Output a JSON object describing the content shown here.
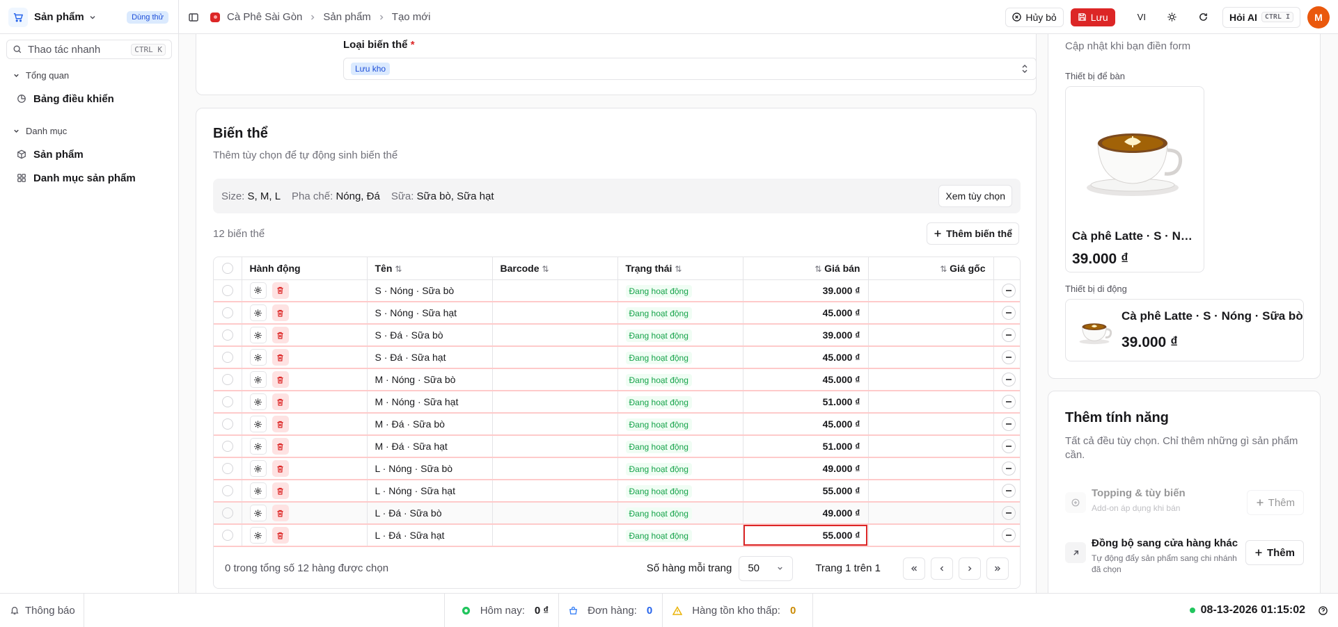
{
  "topbar": {
    "app_name": "Sản phẩm",
    "trial_badge": "Dùng thử",
    "breadcrumb": [
      "Cà Phê Sài Gòn",
      "Sản phẩm",
      "Tạo mới"
    ],
    "cancel_label": "Hủy bỏ",
    "save_label": "Lưu",
    "lang": "VI",
    "ask_ai_label": "Hỏi AI",
    "ask_ai_kbd": "CTRL I",
    "avatar_initial": "M"
  },
  "sidebar": {
    "quick_action_placeholder": "Thao tác nhanh",
    "quick_action_kbd": "CTRL K",
    "groups": [
      {
        "label": "Tổng quan",
        "items": [
          {
            "label": "Bảng điều khiển",
            "icon": "dashboard-icon"
          }
        ]
      },
      {
        "label": "Danh mục",
        "items": [
          {
            "label": "Sản phẩm",
            "icon": "box-icon"
          },
          {
            "label": "Danh mục sản phẩm",
            "icon": "grid-icon"
          }
        ]
      }
    ]
  },
  "variant_type": {
    "label": "Loại biến thể",
    "required_mark": "*",
    "value": "Lưu kho"
  },
  "variants": {
    "title": "Biến thể",
    "subtitle": "Thêm tùy chọn để tự động sinh biến thể",
    "options": [
      {
        "key": "Size:",
        "value": "S, M, L"
      },
      {
        "key": "Pha chế:",
        "value": "Nóng, Đá"
      },
      {
        "key": "Sữa:",
        "value": "Sữa bò, Sữa hạt"
      }
    ],
    "view_options_label": "Xem tùy chọn",
    "count_label": "12 biến thể",
    "add_variant_label": "Thêm biến thể",
    "columns": [
      "Hành động",
      "Tên",
      "Barcode",
      "Trạng thái",
      "Giá bán",
      "Giá gốc"
    ],
    "rows": [
      {
        "name": "S · Nóng · Sữa bò",
        "barcode": "",
        "status": "Đang hoạt động",
        "price": "39.000 ₫",
        "cost": ""
      },
      {
        "name": "S · Nóng · Sữa hạt",
        "barcode": "",
        "status": "Đang hoạt động",
        "price": "45.000 ₫",
        "cost": ""
      },
      {
        "name": "S · Đá · Sữa bò",
        "barcode": "",
        "status": "Đang hoạt động",
        "price": "39.000 ₫",
        "cost": ""
      },
      {
        "name": "S · Đá · Sữa hạt",
        "barcode": "",
        "status": "Đang hoạt động",
        "price": "45.000 ₫",
        "cost": ""
      },
      {
        "name": "M · Nóng · Sữa bò",
        "barcode": "",
        "status": "Đang hoạt động",
        "price": "45.000 ₫",
        "cost": ""
      },
      {
        "name": "M · Nóng · Sữa hạt",
        "barcode": "",
        "status": "Đang hoạt động",
        "price": "51.000 ₫",
        "cost": ""
      },
      {
        "name": "M · Đá · Sữa bò",
        "barcode": "",
        "status": "Đang hoạt động",
        "price": "45.000 ₫",
        "cost": ""
      },
      {
        "name": "M · Đá · Sữa hạt",
        "barcode": "",
        "status": "Đang hoạt động",
        "price": "51.000 ₫",
        "cost": ""
      },
      {
        "name": "L · Nóng · Sữa bò",
        "barcode": "",
        "status": "Đang hoạt động",
        "price": "49.000 ₫",
        "cost": ""
      },
      {
        "name": "L · Nóng · Sữa hạt",
        "barcode": "",
        "status": "Đang hoạt động",
        "price": "55.000 ₫",
        "cost": ""
      },
      {
        "name": "L · Đá · Sữa bò",
        "barcode": "",
        "status": "Đang hoạt động",
        "price": "49.000 ₫",
        "cost": ""
      },
      {
        "name": "L · Đá · Sữa hạt",
        "barcode": "",
        "status": "Đang hoạt động",
        "price": "55.000 ₫",
        "cost": ""
      }
    ],
    "selection_summary": "0 trong tổng số 12 hàng được chọn",
    "rows_per_page_label": "Số hàng mỗi trang",
    "rows_per_page_value": "50",
    "page_label": "Trang 1 trên 1"
  },
  "preview": {
    "subtitle": "Cập nhật khi bạn điền form",
    "desktop_label": "Thiết bị để bàn",
    "mobile_label": "Thiết bị di động",
    "product_name": "Cà phê Latte · S · Nóng · Sữa bò",
    "product_price": "39.000 ₫"
  },
  "features": {
    "title": "Thêm tính năng",
    "description": "Tất cả đều tùy chọn. Chỉ thêm những gì sản phẩm cần.",
    "items": [
      {
        "title": "Topping & tùy biến",
        "desc": "Add-on áp dụng khi bán",
        "button": "Thêm",
        "disabled": true
      },
      {
        "title": "Đồng bộ sang cửa hàng khác",
        "desc": "Tự động đẩy sản phẩm sang chi nhánh đã chọn",
        "button": "Thêm",
        "disabled": false
      }
    ]
  },
  "statusbar": {
    "notifications_label": "Thông báo",
    "today_label": "Hôm nay:",
    "today_value": "0 ₫",
    "orders_label": "Đơn hàng:",
    "orders_value": "0",
    "low_stock_label": "Hàng tồn kho thấp:",
    "low_stock_value": "0",
    "datetime": "08-13-2026 01:15:02"
  },
  "colors": {
    "accent": "#dc2626",
    "status_green": "#16a34a",
    "badge_blue": "#1d4ed8"
  }
}
